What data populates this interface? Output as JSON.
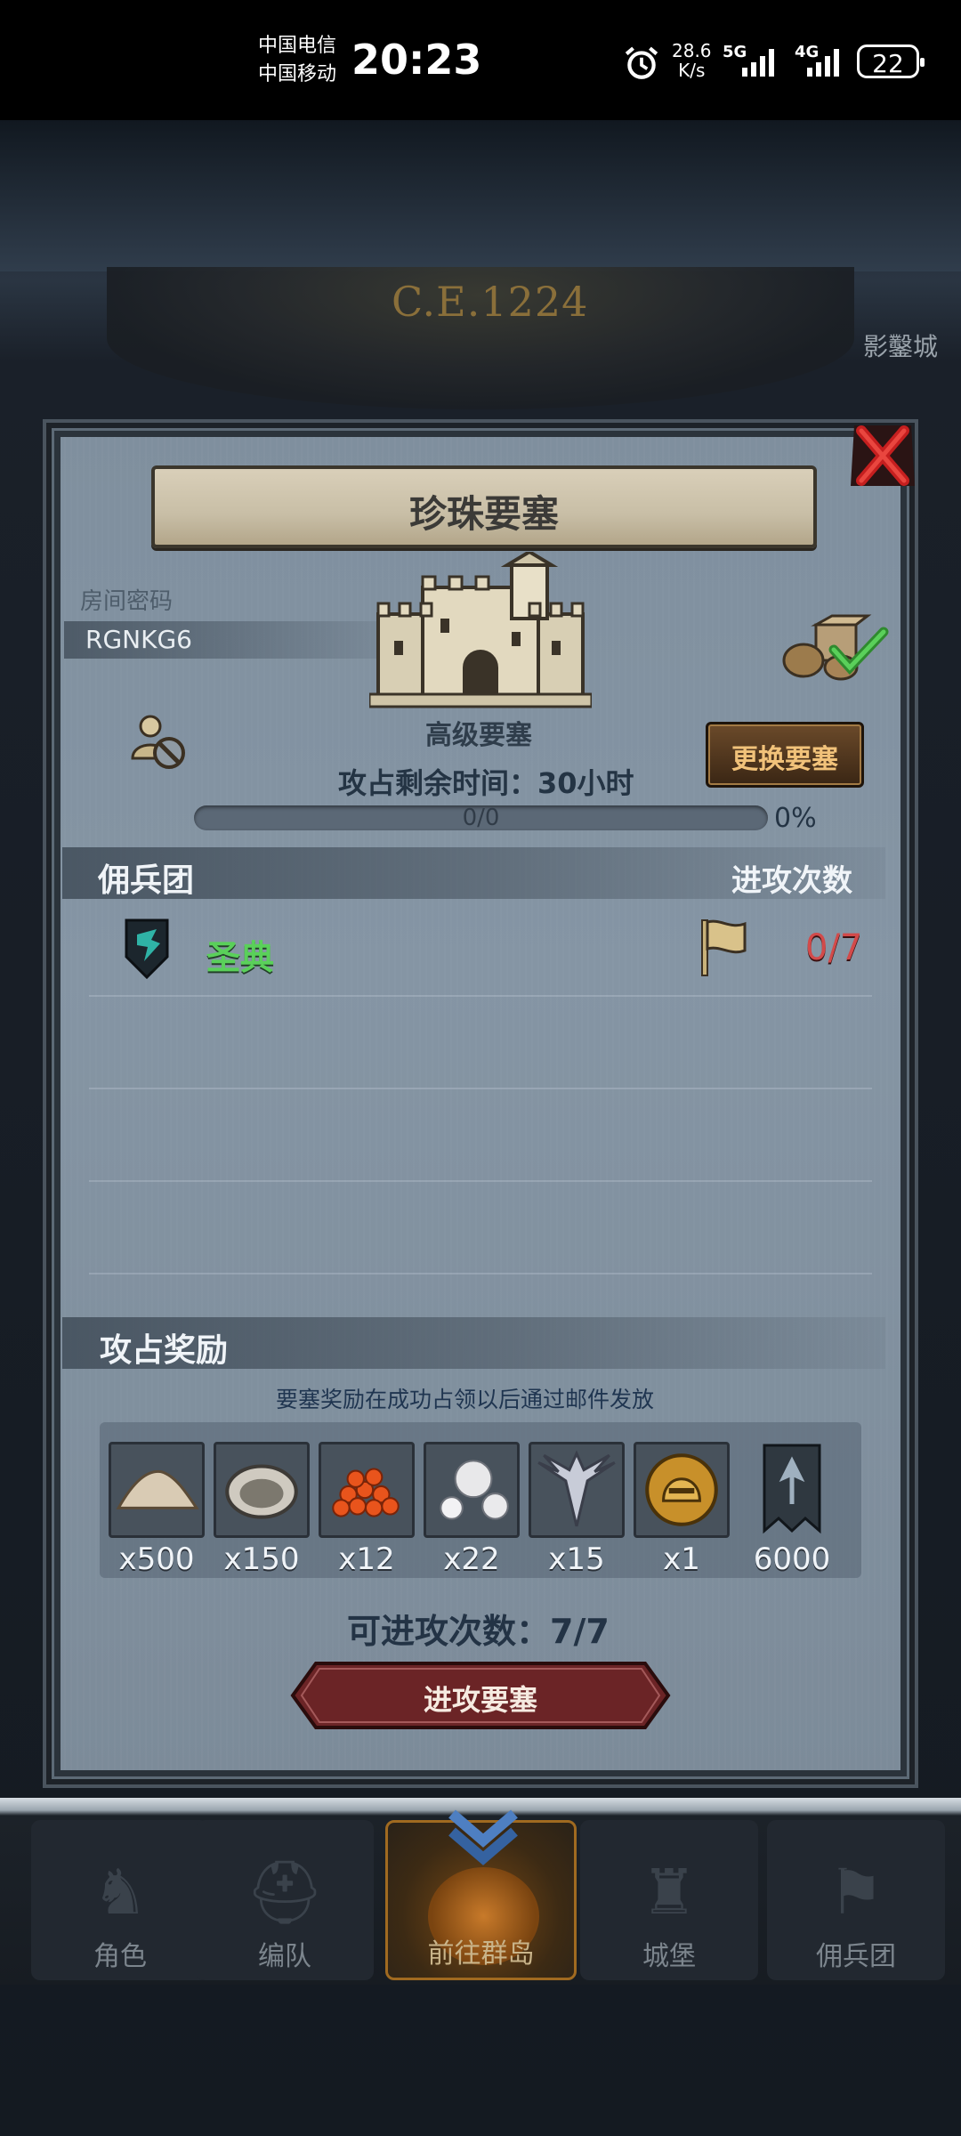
{
  "status_bar": {
    "carrier1": "中国电信",
    "carrier2": "中国移动",
    "time": "20:23",
    "net_speed_value": "28.6",
    "net_speed_unit": "K/s",
    "net1": "5G",
    "net2": "4G",
    "battery": "22"
  },
  "background": {
    "year": "C.E.1224",
    "city_label": "影鑿城"
  },
  "dialog": {
    "title": "珍珠要塞",
    "room_label": "房间密码",
    "room_code": "RGNKG6",
    "fort_level": "高级要塞",
    "time_left": "攻占剩余时间：30小时",
    "progress_text": "0/0",
    "progress_fraction": 0,
    "progress_percent": "0%",
    "change_button": "更换要塞",
    "mercenary_header": "佣兵团",
    "attack_count_header": "进攻次数",
    "guild": {
      "name": "圣典",
      "count": "0/7"
    },
    "rewards_header": "攻占奖励",
    "reward_note": "要塞奖励在成功占领以后通过邮件发放",
    "rewards": [
      {
        "icon": "flour-pile-icon",
        "qty": "x500"
      },
      {
        "icon": "oyster-icon",
        "qty": "x150"
      },
      {
        "icon": "fish-roe-icon",
        "qty": "x12"
      },
      {
        "icon": "pearls-icon",
        "qty": "x22"
      },
      {
        "icon": "winged-crest-icon",
        "qty": "x15"
      },
      {
        "icon": "golden-helmet-medal-icon",
        "qty": "x1"
      },
      {
        "icon": "guild-banner-icon",
        "qty": "6000"
      }
    ],
    "available_attacks": "可进攻次数：7/7",
    "attack_button": "进攻要塞"
  },
  "bottom_nav": [
    {
      "label": "角色",
      "icon": "knight-icon"
    },
    {
      "label": "编队",
      "icon": "helmet-icon"
    },
    {
      "label": "前往群岛",
      "icon": "island-compass-icon",
      "active": true
    },
    {
      "label": "城堡",
      "icon": "castle-icon"
    },
    {
      "label": "佣兵团",
      "icon": "banner-icon"
    }
  ]
}
